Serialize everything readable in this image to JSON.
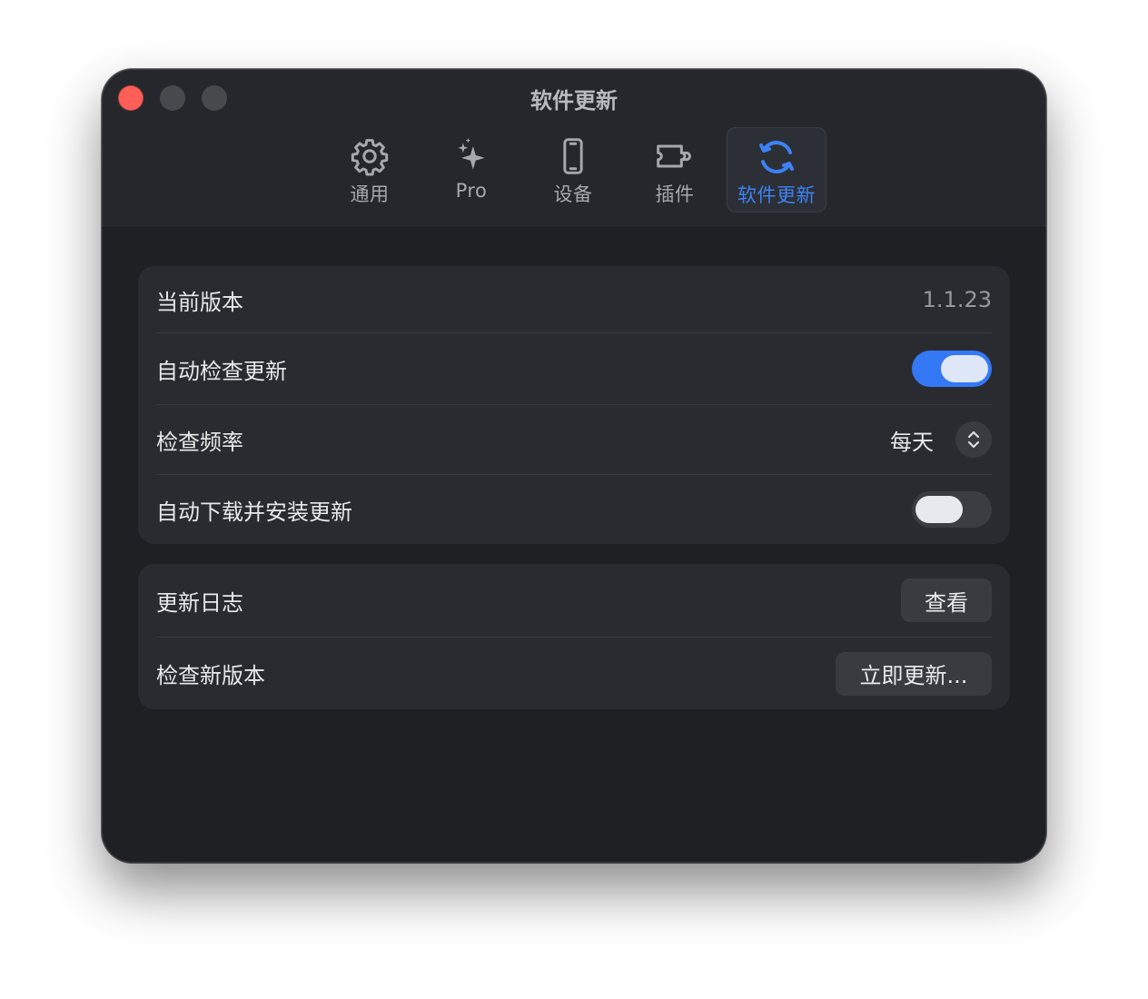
{
  "window": {
    "title": "软件更新"
  },
  "toolbar": {
    "tabs": [
      {
        "label": "通用",
        "icon": "gear-icon",
        "active": false
      },
      {
        "label": "Pro",
        "icon": "sparkles-icon",
        "active": false
      },
      {
        "label": "设备",
        "icon": "phone-icon",
        "active": false
      },
      {
        "label": "插件",
        "icon": "plugin-icon",
        "active": false
      },
      {
        "label": "软件更新",
        "icon": "refresh-icon",
        "active": true
      }
    ]
  },
  "settings": {
    "current_version": {
      "label": "当前版本",
      "value": "1.1.23"
    },
    "auto_check": {
      "label": "自动检查更新",
      "enabled": true
    },
    "check_frequency": {
      "label": "检查频率",
      "value": "每天"
    },
    "auto_download": {
      "label": "自动下载并安装更新",
      "enabled": false
    }
  },
  "actions": {
    "changelog": {
      "label": "更新日志",
      "button": "查看"
    },
    "check_new": {
      "label": "检查新版本",
      "button": "立即更新..."
    }
  },
  "colors": {
    "accent": "#3478f6",
    "close": "#ff5f57",
    "background": "#26272c"
  }
}
